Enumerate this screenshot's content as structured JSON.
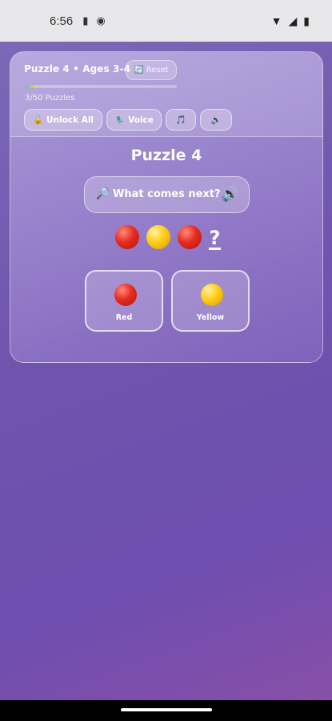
{
  "status_bar": {
    "time": "6:56",
    "icons_left": [
      "sd-card-icon",
      "circle-status-icon"
    ],
    "icons_right": [
      "wifi-icon",
      "signal-icon",
      "battery-icon"
    ]
  },
  "header": {
    "title": "Puzzle 4 • Ages 3-4",
    "reset_icon": "🔄",
    "reset_label": "Reset",
    "progress_fraction": 0.08,
    "progress_label": "3/50 Puzzles",
    "buttons": {
      "unlock_icon": "🔓",
      "unlock_label": "Unlock All",
      "voice_icon": "🎙️",
      "voice_label": "Voice",
      "music_icon": "🎵",
      "sound_icon": "🔈"
    }
  },
  "puzzle": {
    "title": "Puzzle 4",
    "question_icon": "🔎",
    "question": "What comes next?",
    "speaker_icon": "🔊",
    "sequence": [
      "red",
      "yellow",
      "red"
    ],
    "missing": "?"
  },
  "choices": [
    {
      "label": "Red",
      "color": "#e52b1f"
    },
    {
      "label": "Yellow",
      "color": "#ffcc14"
    }
  ],
  "colors": {
    "background": "#6f54ad",
    "red": "#e52b1f",
    "yellow": "#ffcc14"
  }
}
